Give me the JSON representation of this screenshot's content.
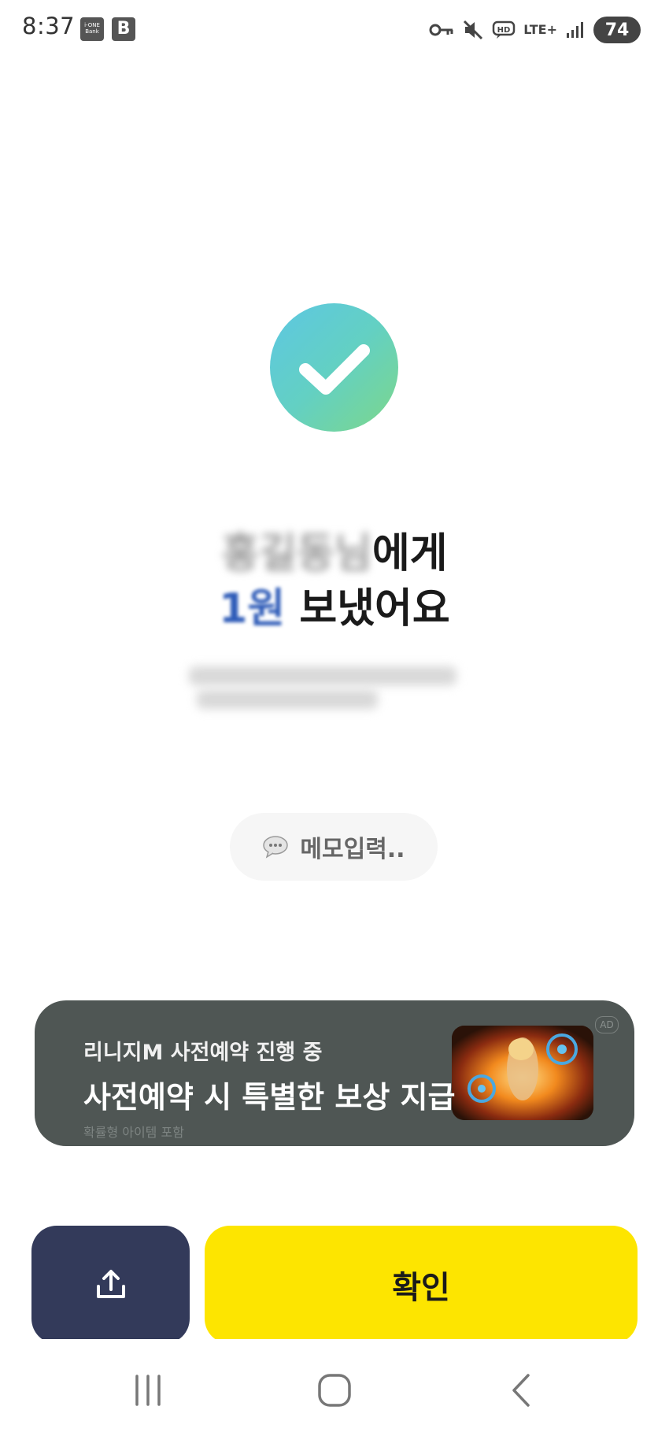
{
  "status_bar": {
    "time": "8:37",
    "app_icon_1_text": "i-ONE Bank",
    "app_icon_2_text": "B",
    "network": "LTE+",
    "battery": "74"
  },
  "result": {
    "headline_line1_blurred": "홍길동님",
    "headline_line1_suffix": "에게",
    "headline_line2_blurred": "1원",
    "headline_line2_suffix": "보냈어요"
  },
  "memo": {
    "label": "메모입력.."
  },
  "ad": {
    "line1": "리니지M 사전예약 진행 중",
    "line2": "사전예약 시 특별한 보상 지급",
    "line3": "확률형 아이템 포함",
    "tag": "AD"
  },
  "actions": {
    "confirm_label": "확인"
  },
  "colors": {
    "confirm_bg": "#fde500",
    "share_bg": "#333a5a",
    "ad_bg": "#4f5654"
  }
}
